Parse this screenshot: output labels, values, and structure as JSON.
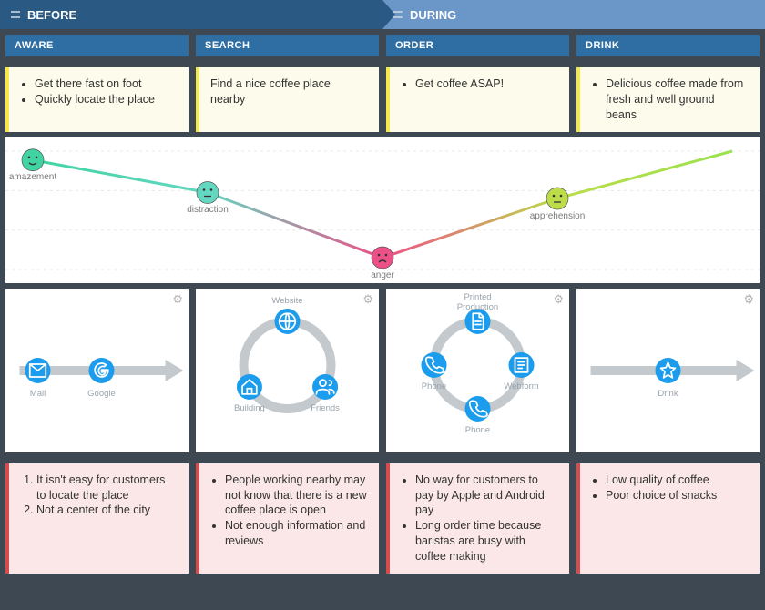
{
  "phases": {
    "before": "BEFORE",
    "during": "DURING"
  },
  "stages": [
    "AWARE",
    "SEARCH",
    "ORDER",
    "DRINK"
  ],
  "needs": [
    {
      "type": "ul",
      "items": [
        "Get there fast on foot",
        "Quickly locate the place"
      ]
    },
    {
      "type": "text",
      "text": "Find a nice coffee place nearby"
    },
    {
      "type": "ul",
      "items": [
        "Get coffee ASAP!"
      ]
    },
    {
      "type": "ul",
      "items": [
        "Delicious coffee made from fresh and well ground beans"
      ]
    }
  ],
  "problems": [
    {
      "type": "ol",
      "items": [
        "It isn't easy for customers to locate the place",
        "Not a center of the city"
      ]
    },
    {
      "type": "ul",
      "items": [
        "People working nearby may not know that there is a new coffee place is open",
        "Not enough information and reviews"
      ]
    },
    {
      "type": "ul",
      "items": [
        "No way for customers to pay by Apple and Android pay",
        "Long order time because baristas are busy with coffee making"
      ]
    },
    {
      "type": "ul",
      "items": [
        "Low quality of coffee",
        "Poor choice of snacks"
      ]
    }
  ],
  "chart_data": {
    "type": "line",
    "title": "",
    "xlabel": "",
    "ylabel": "",
    "ylim": [
      -1,
      1
    ],
    "x": [
      0,
      1,
      2,
      3,
      4
    ],
    "series": [
      {
        "name": "emotion",
        "values": [
          0.85,
          0.3,
          -0.8,
          0.2,
          1.0
        ]
      }
    ],
    "point_labels": [
      "amazement",
      "distraction",
      "anger",
      "apprehension",
      ""
    ],
    "point_colors": [
      "#41d3a2",
      "#63d7c0",
      "#ed4f87",
      "#bcdc4a",
      "#9ae24e"
    ]
  },
  "touchpoints": [
    {
      "layout": "arrow",
      "items": [
        {
          "label": "Mail",
          "icon": "mail"
        },
        {
          "label": "Google",
          "icon": "google"
        }
      ]
    },
    {
      "layout": "ring",
      "items": [
        {
          "label": "Website",
          "icon": "globe"
        },
        {
          "label": "Friends",
          "icon": "users"
        },
        {
          "label": "Building",
          "icon": "home"
        }
      ]
    },
    {
      "layout": "ring",
      "items": [
        {
          "label": "Printed Production",
          "icon": "doc"
        },
        {
          "label": "Webform",
          "icon": "form"
        },
        {
          "label": "Phone",
          "icon": "phone"
        },
        {
          "label": "Phone",
          "icon": "phone"
        }
      ]
    },
    {
      "layout": "arrow",
      "items": [
        {
          "label": "Drink",
          "icon": "star"
        }
      ]
    }
  ]
}
